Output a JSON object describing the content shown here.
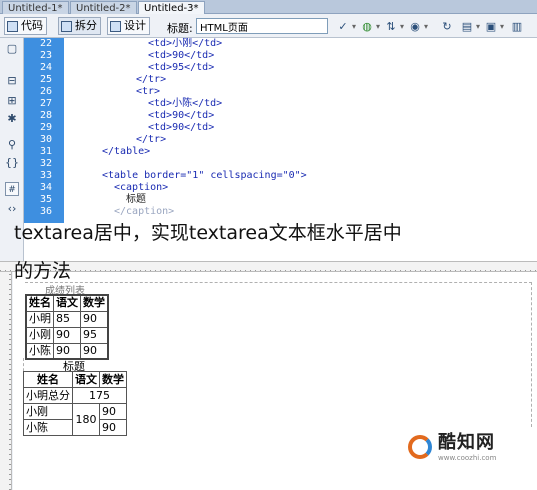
{
  "tabs": [
    "Untitled-1*",
    "Untitled-2*",
    "Untitled-3*"
  ],
  "toolbar": {
    "code_label": "代码",
    "split_label": "拆分",
    "design_label": "设计",
    "title_label": "标题:",
    "title_value": "HTML页面"
  },
  "code_lines": [
    {
      "n": "22",
      "text": "<td>小刚</td>"
    },
    {
      "n": "23",
      "text": "<td>90</td>"
    },
    {
      "n": "24",
      "text": "<td>95</td>"
    },
    {
      "n": "25",
      "text": "</tr>"
    },
    {
      "n": "26",
      "text": "<tr>"
    },
    {
      "n": "27",
      "text": "<td>小陈</td>"
    },
    {
      "n": "28",
      "text": "<td>90</td>"
    },
    {
      "n": "29",
      "text": "<td>90</td>"
    },
    {
      "n": "30",
      "text": "</tr>"
    },
    {
      "n": "31",
      "text": "</table>"
    },
    {
      "n": "32",
      "text": ""
    },
    {
      "n": "33",
      "text": "<table border=\"1\" cellspacing=\"0\">"
    },
    {
      "n": "34",
      "text": "<caption>"
    },
    {
      "n": "35",
      "text": "标题"
    },
    {
      "n": "36",
      "text": "</caption>"
    }
  ],
  "overlay": {
    "line1": "textarea居中，实现textarea文本框水平居中",
    "line2": "的方法"
  },
  "design": {
    "table1_caption": "成绩列表",
    "table1_headers": [
      "姓名",
      "语文",
      "数学"
    ],
    "table1_rows": [
      [
        "小明",
        "85",
        "90"
      ],
      [
        "小刚",
        "90",
        "95"
      ],
      [
        "小陈",
        "90",
        "90"
      ]
    ],
    "table2_caption": "标题",
    "table2_headers": [
      "姓名",
      "语文",
      "数学"
    ],
    "table2_row1": [
      "小明总分",
      "175"
    ],
    "table2_row2_name": "小刚",
    "table2_row3_name": "小陈",
    "table2_merged": "180",
    "table2_row2_math": "90",
    "table2_row3_math": "90"
  },
  "watermark": {
    "name": "酷知网",
    "url": "www.coozhi.com"
  }
}
